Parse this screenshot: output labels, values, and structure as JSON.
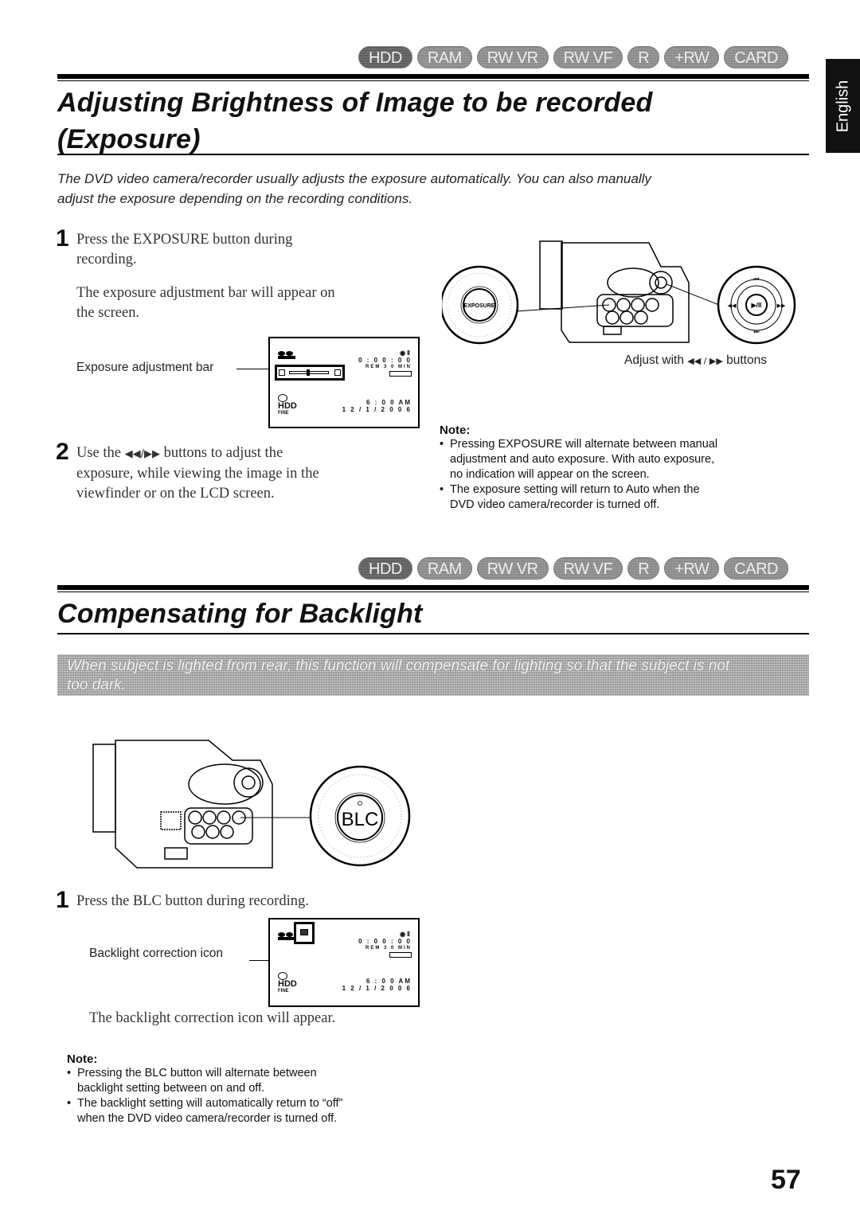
{
  "language_tab": "English",
  "media_badges": [
    "HDD",
    "RAM",
    "RW VR",
    "RW VF",
    "R",
    "+RW",
    "CARD"
  ],
  "section1": {
    "title_line1": "Adjusting Brightness of Image to be recorded",
    "title_line2": "(Exposure)",
    "intro_line1": "The DVD video camera/recorder usually adjusts the exposure automatically. You can also manually",
    "intro_line2": "adjust the exposure depending on the recording conditions.",
    "step1": {
      "number": "1",
      "line1": "Press the EXPOSURE button during",
      "line2": "recording.",
      "result_line1": "The exposure adjustment bar will appear on",
      "result_line2": "the screen."
    },
    "screen_callout": "Exposure adjustment bar",
    "screen": {
      "counter": "0 : 0 0 : 0 0",
      "remaining": "REM 3 0 MIN",
      "media": "HDD",
      "quality": "FINE",
      "time": "6 : 0 0 AM",
      "date": "1 2 /  1 / 2 0 0 6"
    },
    "camera_labels": {
      "button": "EXPOSURE",
      "dial_center": "▶/II"
    },
    "adjust_caption_prefix": "Adjust with ",
    "adjust_caption_symbols": "◀◀ / ▶▶",
    "adjust_caption_suffix": " buttons",
    "step2": {
      "number": "2",
      "line1_prefix": "Use the ",
      "line1_symbols": "◀◀/▶▶",
      "line1_suffix": " buttons to adjust the",
      "line2": "exposure, while viewing the image in the",
      "line3": "viewfinder or on the LCD screen."
    },
    "note": {
      "title": "Note:",
      "items": [
        [
          "Pressing EXPOSURE will alternate between manual",
          "adjustment and auto exposure. With auto exposure,",
          "no indication will appear on the screen."
        ],
        [
          "The exposure setting will return to Auto when the",
          "DVD video camera/recorder is turned off."
        ]
      ]
    }
  },
  "section2": {
    "title": "Compensating for Backlight",
    "intro_line1": "When subject is lighted from rear, this function will compensate for lighting so that the subject is not",
    "intro_line2": "too dark.",
    "camera_labels": {
      "button": "BLC"
    },
    "step1": {
      "number": "1",
      "line1": "Press the BLC button during recording.",
      "result": "The backlight correction icon will appear."
    },
    "screen_callout": "Backlight correction icon",
    "screen": {
      "counter": "0 : 0 0 : 0 0",
      "remaining": "REM 3 0 MIN",
      "media": "HDD",
      "quality": "FINE",
      "time": "6 : 0 0 AM",
      "date": "1 2 /  1 / 2 0 0 6"
    },
    "note": {
      "title": "Note:",
      "items": [
        [
          "Pressing the BLC button will alternate between",
          "backlight setting between on and off."
        ],
        [
          "The backlight setting will automatically return to “off”",
          "when the DVD video camera/recorder is turned off."
        ]
      ]
    }
  },
  "page_number": "57"
}
